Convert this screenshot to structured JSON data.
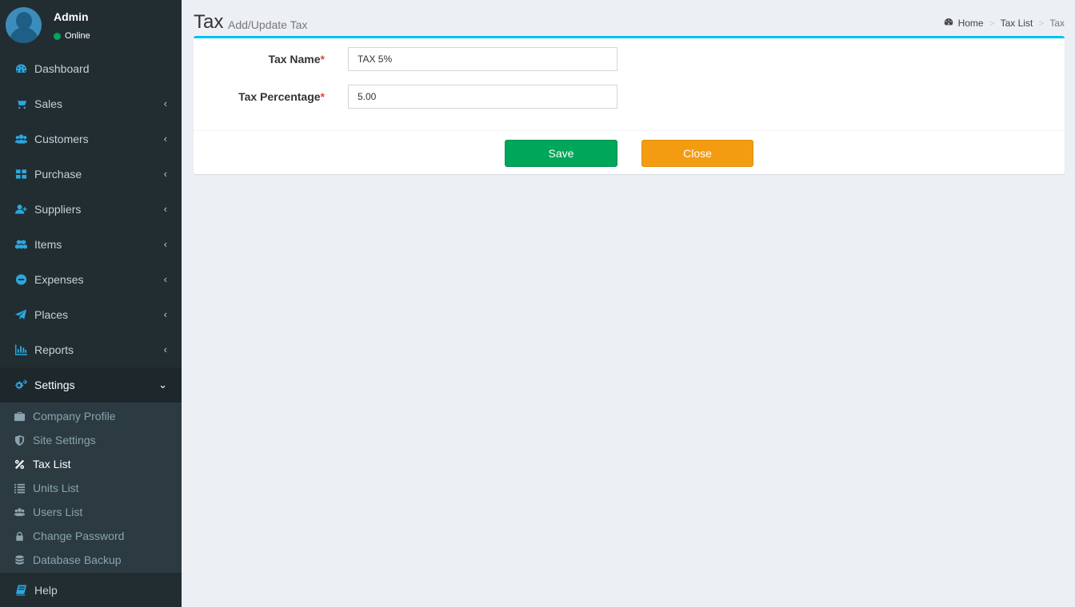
{
  "user": {
    "name": "Admin",
    "status": "Online"
  },
  "menu": [
    {
      "label": "Dashboard",
      "icon": "dashboard-icon",
      "has_children": false
    },
    {
      "label": "Sales",
      "icon": "cart-icon",
      "has_children": true
    },
    {
      "label": "Customers",
      "icon": "users-icon",
      "has_children": true
    },
    {
      "label": "Purchase",
      "icon": "grid-icon",
      "has_children": true
    },
    {
      "label": "Suppliers",
      "icon": "user-plus-icon",
      "has_children": true
    },
    {
      "label": "Items",
      "icon": "cubes-icon",
      "has_children": true
    },
    {
      "label": "Expenses",
      "icon": "minus-circle-icon",
      "has_children": true
    },
    {
      "label": "Places",
      "icon": "paper-plane-icon",
      "has_children": true
    },
    {
      "label": "Reports",
      "icon": "bar-chart-icon",
      "has_children": true
    },
    {
      "label": "Settings",
      "icon": "gears-icon",
      "has_children": true,
      "expanded": true
    }
  ],
  "settings_submenu": [
    {
      "label": "Company Profile",
      "icon": "briefcase-icon"
    },
    {
      "label": "Site Settings",
      "icon": "shield-icon"
    },
    {
      "label": "Tax List",
      "icon": "percent-icon",
      "active": true
    },
    {
      "label": "Units List",
      "icon": "list-icon"
    },
    {
      "label": "Users List",
      "icon": "users-icon"
    },
    {
      "label": "Change Password",
      "icon": "lock-icon"
    },
    {
      "label": "Database Backup",
      "icon": "database-icon"
    }
  ],
  "help": {
    "label": "Help",
    "icon": "book-icon"
  },
  "header": {
    "title": "Tax",
    "subtitle": "Add/Update Tax",
    "breadcrumb": [
      "Home",
      "Tax List",
      "Tax"
    ]
  },
  "form": {
    "tax_name_label": "Tax Name",
    "tax_name_value": "TAX 5%",
    "tax_percentage_label": "Tax Percentage",
    "tax_percentage_value": "5.00",
    "required_mark": "*",
    "save_label": "Save",
    "close_label": "Close"
  },
  "colors": {
    "sidebar_bg": "#222d32",
    "submenu_bg": "#2c3b41",
    "accent": "#00c0ef",
    "save": "#00a65a",
    "close": "#f39c12",
    "online": "#00a65a"
  }
}
